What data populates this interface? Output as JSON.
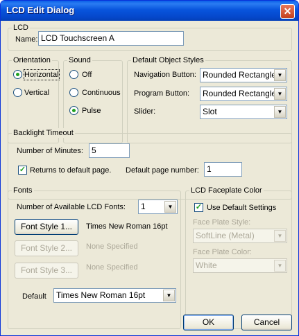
{
  "window": {
    "title": "LCD Edit Dialog",
    "close_glyph": "✕"
  },
  "lcd": {
    "legend": "LCD",
    "name_label": "Name:",
    "name_value": "LCD Touchscreen A"
  },
  "orientation": {
    "legend": "Orientation",
    "options": [
      "Horizontal",
      "Vertical"
    ],
    "selected": "Horizontal"
  },
  "sound": {
    "legend": "Sound",
    "options": [
      "Off",
      "Continuous",
      "Pulse"
    ],
    "selected": "Pulse"
  },
  "object_styles": {
    "legend": "Default Object Styles",
    "navigation_label": "Navigation Button:",
    "navigation_value": "Rounded Rectangle",
    "program_label": "Program Button:",
    "program_value": "Rounded Rectangle",
    "slider_label": "Slider:",
    "slider_value": "Slot"
  },
  "backlight": {
    "legend": "Backlight Timeout",
    "minutes_label": "Number of Minutes:",
    "minutes_value": "5",
    "returns_label": "Returns to default page.",
    "returns_checked": true,
    "page_label": "Default page number:",
    "page_value": "1"
  },
  "fonts": {
    "legend": "Fonts",
    "count_label": "Number of Available LCD Fonts:",
    "count_value": "1",
    "styles": [
      {
        "button": "Font Style 1...",
        "value": "Times New Roman 16pt",
        "enabled": true
      },
      {
        "button": "Font Style 2...",
        "value": "None Specified",
        "enabled": false
      },
      {
        "button": "Font Style 3...",
        "value": "None Specified",
        "enabled": false
      }
    ],
    "default_label": "Default",
    "default_value": "Times New Roman 16pt"
  },
  "faceplate": {
    "legend": "LCD Faceplate Color",
    "use_default_label": "Use Default Settings",
    "use_default_checked": true,
    "style_label": "Face Plate Style:",
    "style_value": "SoftLine (Metal)",
    "color_label": "Face Plate Color:",
    "color_value": "White"
  },
  "buttons": {
    "ok": "OK",
    "cancel": "Cancel"
  },
  "icons": {
    "dropdown_arrow": "▼",
    "check_mark": "✓"
  },
  "colors": {
    "title_bar": "#0855dd",
    "dialog_bg": "#ece9d8",
    "close_button": "#d9542c",
    "radio_dot": "#21a121"
  }
}
